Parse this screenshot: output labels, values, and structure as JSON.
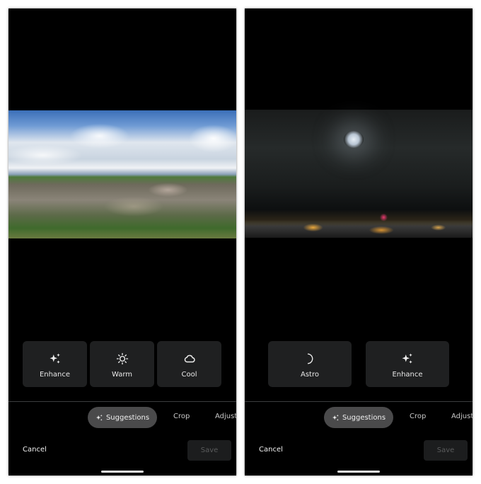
{
  "screens": [
    {
      "photo": "city daytime",
      "suggestions": [
        {
          "label": "Enhance",
          "icon": "sparkle-icon"
        },
        {
          "label": "Warm",
          "icon": "sun-icon"
        },
        {
          "label": "Cool",
          "icon": "cloud-icon"
        }
      ],
      "tabs": {
        "active": "Suggestions",
        "items": [
          "Crop",
          "Adjust"
        ]
      },
      "cancel_label": "Cancel",
      "save_label": "Save"
    },
    {
      "photo": "city night moon",
      "suggestions": [
        {
          "label": "Astro",
          "icon": "moon-icon"
        },
        {
          "label": "Enhance",
          "icon": "sparkle-icon"
        }
      ],
      "tabs": {
        "active": "Suggestions",
        "items": [
          "Crop",
          "Adjust"
        ]
      },
      "cancel_label": "Cancel",
      "save_label": "Save"
    }
  ],
  "colors": {
    "chip_bg": "#1f2021",
    "pill_bg": "#4a4a4b",
    "save_disabled": "#1c1d1e"
  }
}
